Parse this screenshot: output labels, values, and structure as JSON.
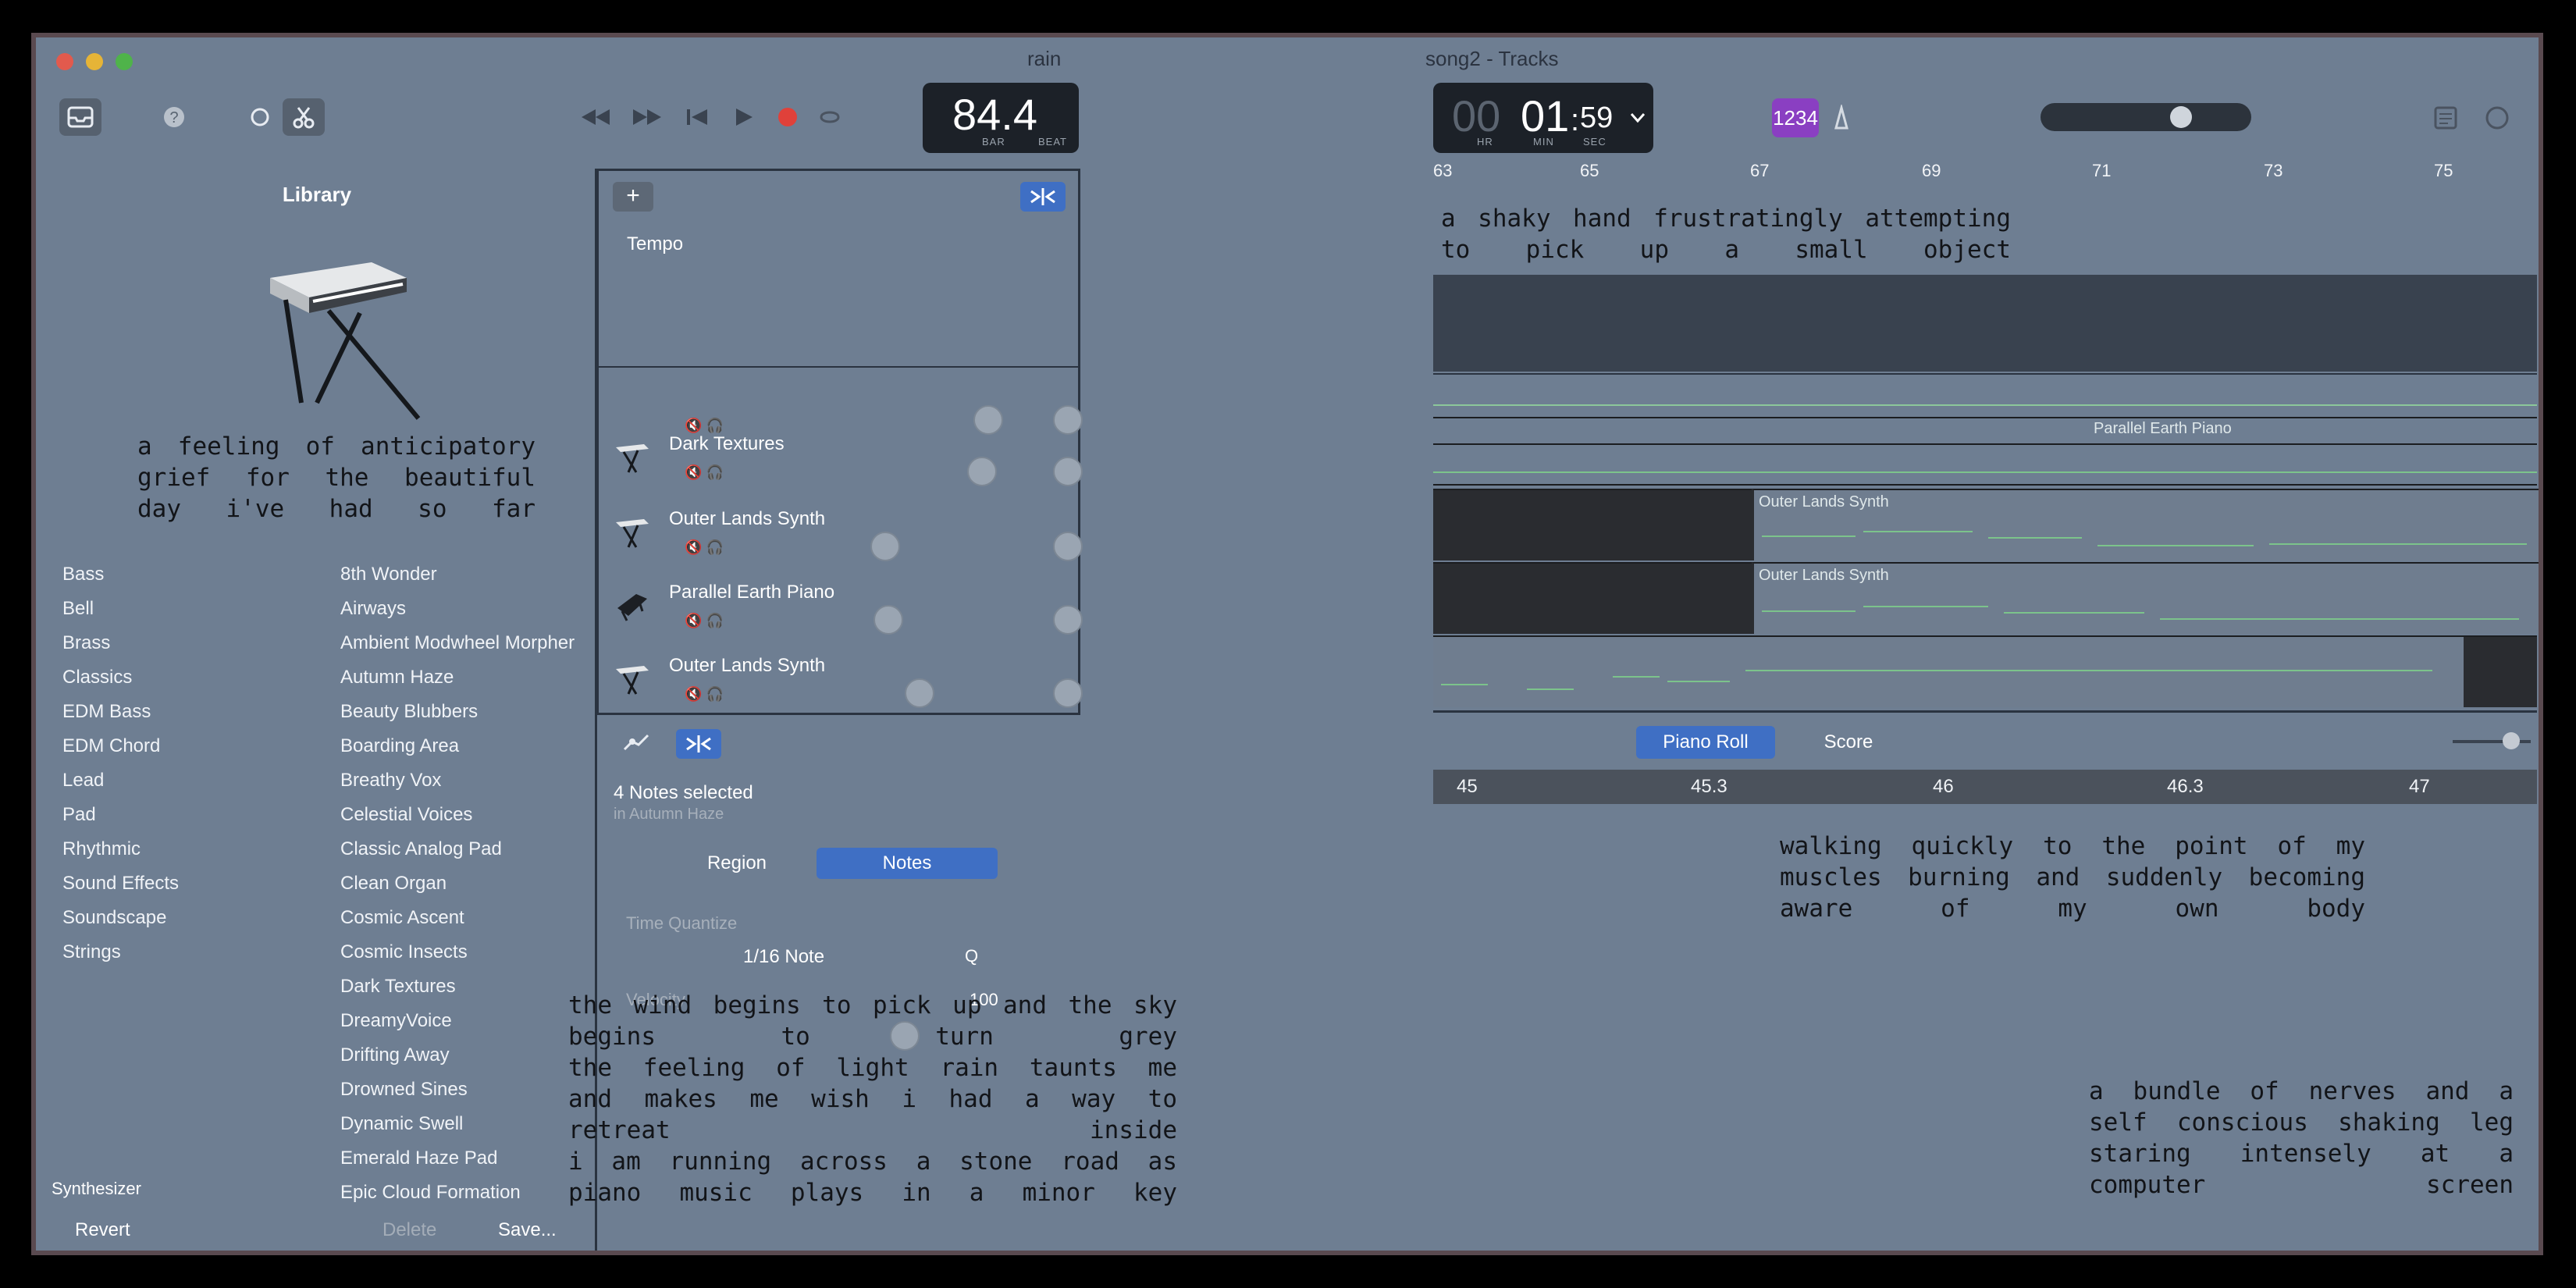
{
  "window": {
    "title_left": "rain",
    "title_right": "song2 - Tracks"
  },
  "toolbar": {
    "lcd_beats": "84.4",
    "lcd_bar_label": "BAR",
    "lcd_beat_label": "BEAT",
    "lcd_time_hr": "00",
    "lcd_time_min": "01",
    "lcd_time_sec": "59",
    "lcd_hr_label": "HR",
    "lcd_min_label": "MIN",
    "lcd_sec_label": "SEC",
    "count_in": "1234"
  },
  "library": {
    "title": "Library",
    "categories": [
      "Bass",
      "Bell",
      "Brass",
      "Classics",
      "EDM Bass",
      "EDM Chord",
      "Lead",
      "Pad",
      "Rhythmic",
      "Sound Effects",
      "Soundscape",
      "Strings"
    ],
    "patches": [
      "8th Wonder",
      "Airways",
      "Ambient Modwheel Morpher",
      "Autumn Haze",
      "Beauty Blubbers",
      "Boarding Area",
      "Breathy Vox",
      "Celestial Voices",
      "Classic Analog Pad",
      "Clean Organ",
      "Cosmic Ascent",
      "Cosmic Insects",
      "Dark Textures",
      "DreamyVoice",
      "Drifting Away",
      "Drowned Sines",
      "Dynamic Swell",
      "Emerald Haze Pad",
      "Epic Cloud Formation"
    ],
    "footer_label": "Synthesizer",
    "revert": "Revert",
    "delete": "Delete",
    "save": "Save..."
  },
  "tracks": {
    "tempo_label": "Tempo",
    "items": [
      "Dark Textures",
      "Outer Lands Synth",
      "Parallel Earth Piano",
      "Outer Lands Synth"
    ]
  },
  "inspector": {
    "selection": "4 Notes selected",
    "selection_sub": "in Autumn Haze",
    "tab_region": "Region",
    "tab_notes": "Notes",
    "time_quantize_label": "Time Quantize",
    "time_quantize_value": "1/16 Note",
    "q_label": "Q",
    "velocity_label": "Velocity",
    "velocity_value": "100"
  },
  "arrange": {
    "ruler": [
      "63",
      "65",
      "67",
      "69",
      "71",
      "73",
      "75"
    ],
    "regions": [
      "Parallel Earth Piano",
      "Outer Lands Synth",
      "Outer Lands Synth"
    ]
  },
  "editor": {
    "piano_roll": "Piano Roll",
    "score": "Score",
    "ruler": [
      "45",
      "45.3",
      "46",
      "46.3",
      "47"
    ]
  },
  "overlay": {
    "left_top": [
      "a feeling of anticipatory",
      "grief for the beautiful",
      "day i've had so far"
    ],
    "center_bottom": [
      "the wind begins to pick up and the sky",
      "begins to turn grey",
      "the feeling of light rain taunts me",
      "and makes me wish i had a way to",
      "retreat inside",
      "i am running across a stone road as",
      "piano music plays in a minor key"
    ],
    "right_top": [
      "a shaky hand frustratingly attempting",
      "to pick up a small object"
    ],
    "right_mid": [
      "walking quickly to the point of my",
      "muscles burning and suddenly becoming",
      "aware of my own body"
    ],
    "right_bottom": [
      "a bundle of nerves and a",
      "self conscious shaking leg",
      "staring intensely at a",
      "computer screen"
    ]
  },
  "colors": {
    "background": "#6e7e92",
    "accent_blue": "#3f6fc4",
    "count_in_purple": "#8a3fc2",
    "record_red": "#e0413a",
    "region_green": "#7cc38b"
  }
}
